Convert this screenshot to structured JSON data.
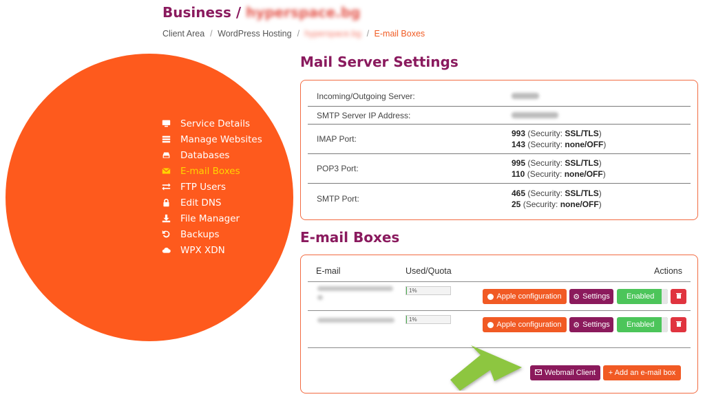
{
  "header": {
    "title_prefix": "Business /",
    "title_blurred": "hyperspace.bg"
  },
  "breadcrumb": [
    {
      "label": "Client Area"
    },
    {
      "label": "WordPress Hosting"
    },
    {
      "label": "hyperspace.bg"
    },
    {
      "label": "E-mail Boxes"
    }
  ],
  "sidebar": {
    "items": [
      {
        "label": "Service Details",
        "icon": "monitor-icon"
      },
      {
        "label": "Manage Websites",
        "icon": "list-icon"
      },
      {
        "label": "Databases",
        "icon": "database-icon"
      },
      {
        "label": "E-mail Boxes",
        "icon": "envelope-icon",
        "active": true
      },
      {
        "label": "FTP Users",
        "icon": "exchange-icon"
      },
      {
        "label": "Edit DNS",
        "icon": "lock-icon"
      },
      {
        "label": "File Manager",
        "icon": "download-icon"
      },
      {
        "label": "Backups",
        "icon": "history-icon"
      },
      {
        "label": "WPX XDN",
        "icon": "cloud-icon"
      }
    ]
  },
  "mail_server": {
    "title": "Mail Server Settings",
    "rows": [
      {
        "label": "Incoming/Outgoing Server:"
      },
      {
        "label": "SMTP Server IP Address:"
      },
      {
        "label": "IMAP Port:",
        "lines": [
          {
            "port": "993",
            "pre": " (Security: ",
            "sec": "SSL/TLS",
            "post": ")"
          },
          {
            "port": "143",
            "pre": " (Security: ",
            "sec": "none/OFF",
            "post": ")"
          }
        ]
      },
      {
        "label": "POP3 Port:",
        "lines": [
          {
            "port": "995",
            "pre": " (Security: ",
            "sec": "SSL/TLS",
            "post": ")"
          },
          {
            "port": "110",
            "pre": " (Security: ",
            "sec": "none/OFF",
            "post": ")"
          }
        ]
      },
      {
        "label": "SMTP Port:",
        "lines": [
          {
            "port": "465",
            "pre": " (Security: ",
            "sec": "SSL/TLS",
            "post": ")"
          },
          {
            "port": "25",
            "pre": " (Security: ",
            "sec": "none/OFF",
            "post": ")"
          }
        ]
      }
    ]
  },
  "email_boxes": {
    "title": "E-mail Boxes",
    "columns": {
      "email": "E-mail",
      "quota": "Used/Quota",
      "actions": "Actions"
    },
    "rows": [
      {
        "quota_text": "1%",
        "quota_fraction": 0.01,
        "apple_label": "Apple configuration",
        "settings_label": "Settings",
        "status_label": "Enabled"
      },
      {
        "quota_text": "1%",
        "quota_fraction": 0.01,
        "apple_label": "Apple configuration",
        "settings_label": "Settings",
        "status_label": "Enabled"
      }
    ],
    "webmail_label": "Webmail Client",
    "add_label": "+ Add an e-mail box"
  },
  "colors": {
    "brand_purple": "#8a1a5e",
    "brand_orange": "#fe5a1d",
    "active_yellow": "#ffd400",
    "enabled_green": "#4cc55a",
    "arrow_green": "#8dc63f"
  }
}
